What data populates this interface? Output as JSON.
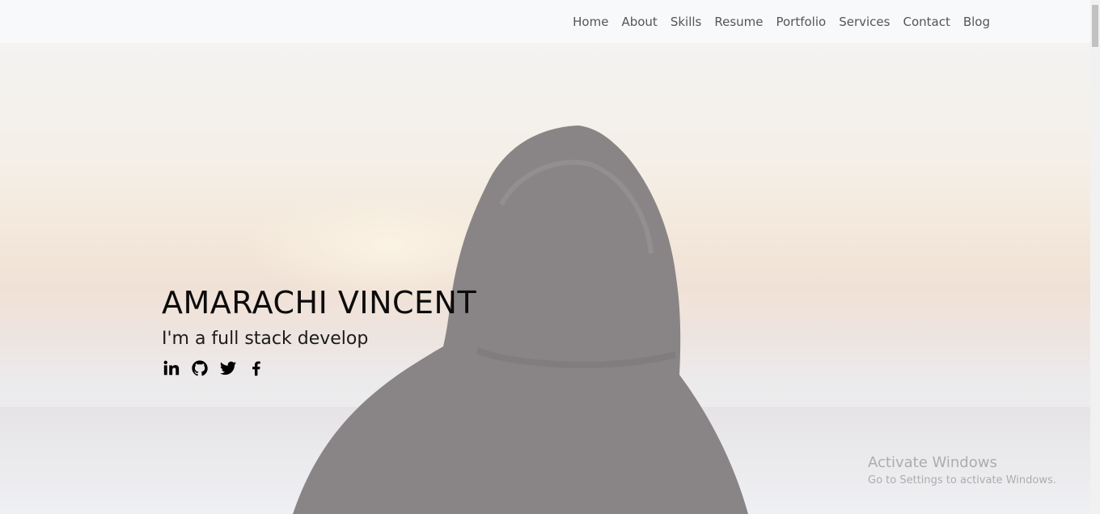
{
  "nav": {
    "items": [
      {
        "label": "Home"
      },
      {
        "label": "About"
      },
      {
        "label": "Skills"
      },
      {
        "label": "Resume"
      },
      {
        "label": "Portfolio"
      },
      {
        "label": "Services"
      },
      {
        "label": "Contact"
      },
      {
        "label": "Blog"
      }
    ]
  },
  "hero": {
    "title": "AMARACHI VINCENT",
    "subtitle": "I'm a full stack develop",
    "social": [
      {
        "icon": "linkedin-icon"
      },
      {
        "icon": "github-icon"
      },
      {
        "icon": "twitter-icon"
      },
      {
        "icon": "facebook-icon"
      }
    ]
  },
  "watermark": {
    "title": "Activate Windows",
    "subtitle": "Go to Settings to activate Windows."
  },
  "colors": {
    "nav_bg": "#f8f9fa",
    "nav_text": "#555555",
    "title_text": "#0b0b0b"
  }
}
